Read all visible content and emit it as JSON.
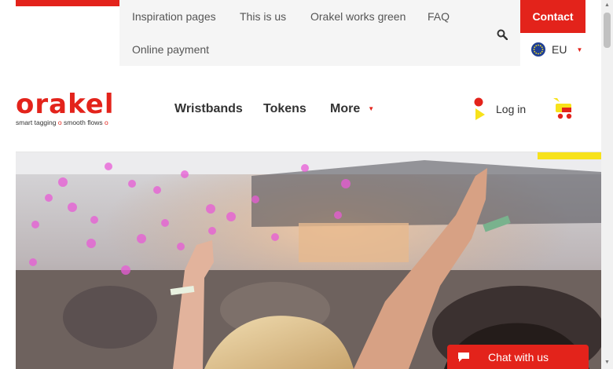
{
  "topbar": {
    "links": [
      "Inspiration pages",
      "This is us",
      "Orakel works green",
      "FAQ",
      "Online payment"
    ],
    "contact_label": "Contact",
    "region_label": "EU",
    "search_icon": "search-icon"
  },
  "brand": {
    "name": "orakel",
    "tagline_1": "smart tagging",
    "tagline_sep": "o",
    "tagline_2": "smooth flows",
    "tagline_end": "o",
    "color": "#e3231b"
  },
  "nav": {
    "wristbands": "Wristbands",
    "tokens": "Tokens",
    "more": "More"
  },
  "account": {
    "login_label": "Log in"
  },
  "chat": {
    "label": "Chat with us"
  },
  "colors": {
    "accent": "#e3231b",
    "highlight": "#f7e21b",
    "topbar_bg": "#f5f5f5"
  }
}
